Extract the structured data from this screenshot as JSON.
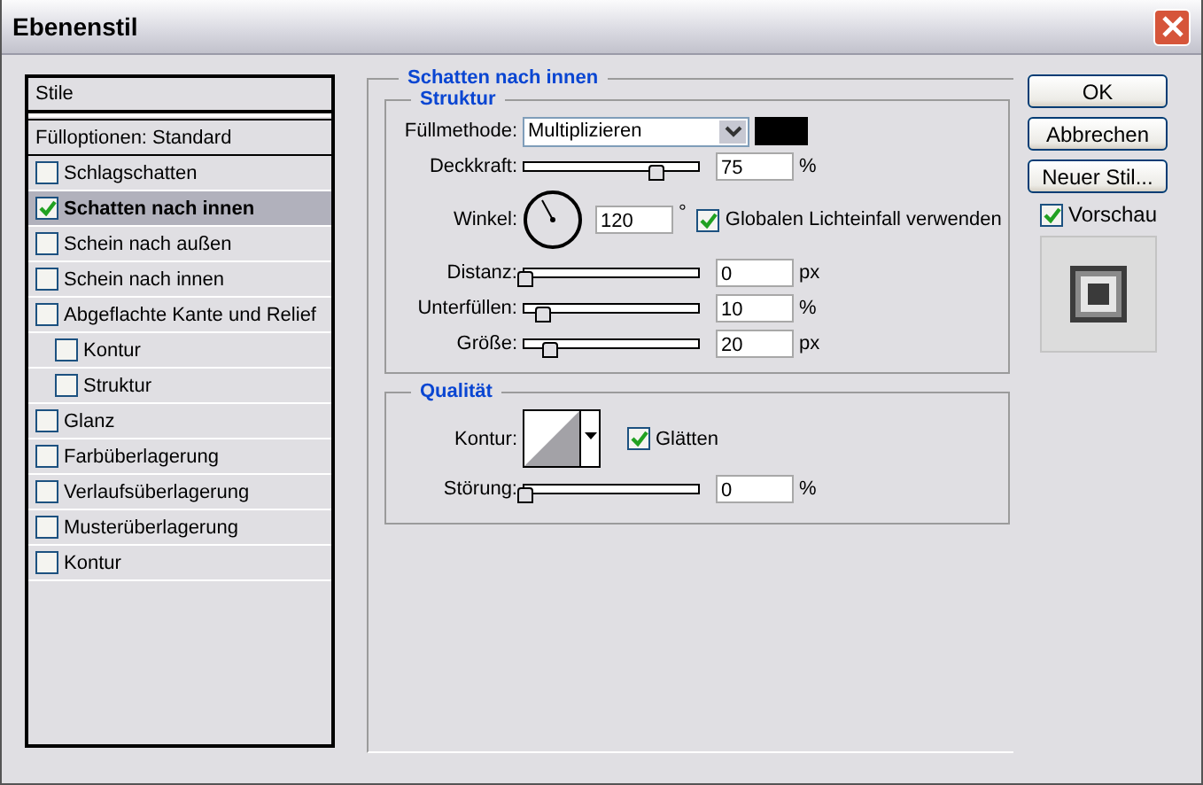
{
  "window": {
    "title": "Ebenenstil"
  },
  "styles_list": {
    "header": "Stile",
    "items": [
      {
        "label": "Fülloptionen: Standard",
        "kind": "plain",
        "selected": false
      },
      {
        "label": "Schlagschatten",
        "kind": "check",
        "checked": false,
        "selected": false
      },
      {
        "label": "Schatten nach innen",
        "kind": "check",
        "checked": true,
        "selected": true
      },
      {
        "label": "Schein nach außen",
        "kind": "check",
        "checked": false,
        "selected": false
      },
      {
        "label": "Schein nach innen",
        "kind": "check",
        "checked": false,
        "selected": false
      },
      {
        "label": "Abgeflachte Kante und Relief",
        "kind": "check",
        "checked": false,
        "selected": false,
        "children": [
          {
            "label": "Kontur",
            "kind": "check",
            "checked": false,
            "selected": false
          },
          {
            "label": "Struktur",
            "kind": "check",
            "checked": false,
            "selected": false
          }
        ]
      },
      {
        "label": "Glanz",
        "kind": "check",
        "checked": false,
        "selected": false
      },
      {
        "label": "Farbüberlagerung",
        "kind": "check",
        "checked": false,
        "selected": false
      },
      {
        "label": "Verlaufsüberlagerung",
        "kind": "check",
        "checked": false,
        "selected": false
      },
      {
        "label": "Musterüberlagerung",
        "kind": "check",
        "checked": false,
        "selected": false
      },
      {
        "label": "Kontur",
        "kind": "check",
        "checked": false,
        "selected": false
      }
    ]
  },
  "panel": {
    "title": "Schatten nach innen",
    "structure": {
      "title": "Struktur",
      "blend_mode": {
        "label": "Füllmethode:",
        "value": "Multiplizieren",
        "color": "#000000"
      },
      "opacity": {
        "label": "Deckkraft:",
        "level": 0.75,
        "value": "75",
        "unit": "%"
      },
      "angle": {
        "label": "Winkel:",
        "value": "120",
        "unit": "°",
        "global_light": {
          "label": "Globalen Lichteinfall verwenden",
          "checked": true
        }
      },
      "sliders": [
        {
          "label": "Distanz:",
          "level": 0,
          "value": "0",
          "unit": "px"
        },
        {
          "label": "Unterfüllen:",
          "level": 0.1,
          "value": "10",
          "unit": "%"
        },
        {
          "label": "Größe:",
          "level": 0.14,
          "value": "20",
          "unit": "px"
        }
      ]
    },
    "quality": {
      "title": "Qualität",
      "contour": {
        "label": "Kontur:"
      },
      "antialias": {
        "label": "Glätten",
        "checked": true
      },
      "noise": {
        "label": "Störung:",
        "level": 0,
        "value": "0",
        "unit": "%"
      }
    }
  },
  "buttons": [
    "OK",
    "Abbrechen",
    "Neuer Stil..."
  ],
  "preview": {
    "label": "Vorschau",
    "checked": true
  }
}
